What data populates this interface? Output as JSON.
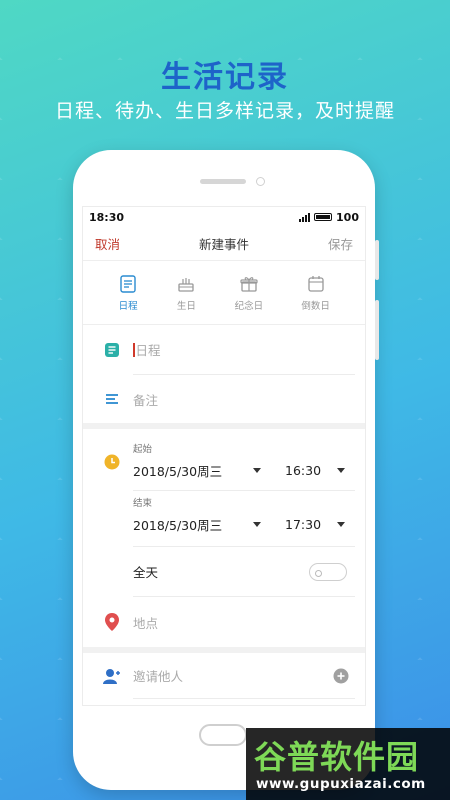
{
  "hero": {
    "title": "生活记录",
    "subtitle": "日程、待办、生日多样记录，及时提醒"
  },
  "statusbar": {
    "time": "18:30",
    "battery": "100"
  },
  "navbar": {
    "cancel": "取消",
    "title": "新建事件",
    "save": "保存"
  },
  "types": [
    {
      "label": "日程",
      "icon": "schedule-icon",
      "active": true
    },
    {
      "label": "生日",
      "icon": "cake-icon",
      "active": false
    },
    {
      "label": "纪念日",
      "icon": "gift-icon",
      "active": false
    },
    {
      "label": "倒数日",
      "icon": "calendar-icon",
      "active": false
    }
  ],
  "form": {
    "title_placeholder": "日程",
    "note_placeholder": "备注",
    "start_label": "起始",
    "start_date": "2018/5/30周三",
    "start_time": "16:30",
    "end_label": "结束",
    "end_date": "2018/5/30周三",
    "end_time": "17:30",
    "allday_label": "全天",
    "location_placeholder": "地点",
    "invite_placeholder": "邀请他人"
  },
  "colors": {
    "accent": "#2a8bd0",
    "cancel": "#c0392b",
    "clock": "#f0b429",
    "location": "#e04f4f",
    "title_icon": "#2bb0a8"
  },
  "watermark": {
    "text": "谷普软件园",
    "url": "www.gupuxiazai.com"
  }
}
